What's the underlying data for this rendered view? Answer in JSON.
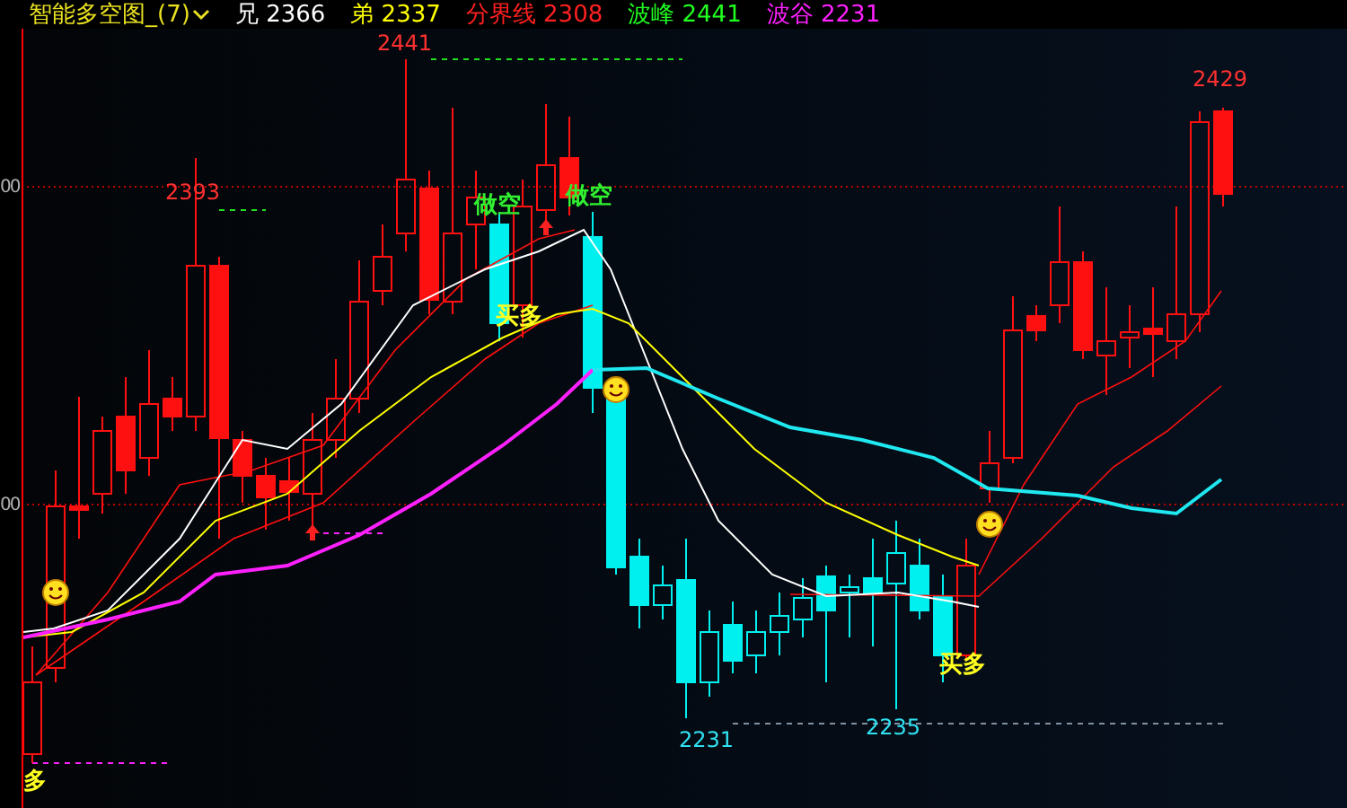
{
  "header": {
    "title": "智能多空图_(7)",
    "indicators": [
      {
        "label": "兄",
        "value": "2366",
        "color": "#ffffff"
      },
      {
        "label": "弟",
        "value": "2337",
        "color": "#ffff00"
      },
      {
        "label": "分界线",
        "value": "2308",
        "color": "#ff2020"
      },
      {
        "label": "波峰",
        "value": "2441",
        "color": "#20ff20"
      },
      {
        "label": "波谷",
        "value": "2231",
        "color": "#ff20ff"
      }
    ]
  },
  "axis": {
    "ticks": [
      "00",
      "00"
    ]
  },
  "chart": {
    "prices": [
      {
        "text": "2441",
        "color": "#ff3030"
      },
      {
        "text": "2393",
        "color": "#ff3030"
      },
      {
        "text": "2429",
        "color": "#ff3030"
      },
      {
        "text": "2231",
        "color": "#30e0f0"
      },
      {
        "text": "2235",
        "color": "#30e0f0"
      }
    ],
    "signals": [
      {
        "kind": "short",
        "text": "做空"
      },
      {
        "kind": "short",
        "text": "做空"
      },
      {
        "kind": "long",
        "text": "买多"
      },
      {
        "kind": "long",
        "text": "买多"
      },
      {
        "kind": "long",
        "text": "多"
      }
    ]
  }
}
